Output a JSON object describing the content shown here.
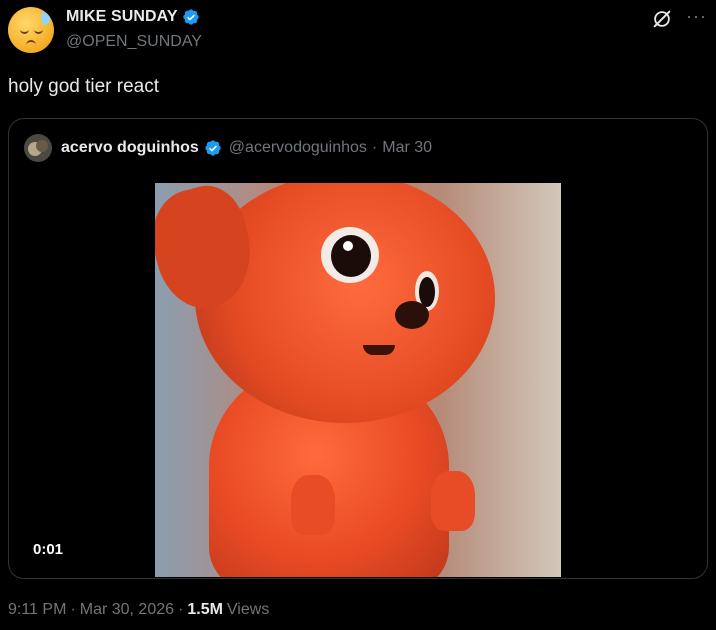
{
  "author": {
    "display_name": "MIKE SUNDAY",
    "handle": "@OPEN_SUNDAY",
    "verified": true,
    "avatar_icon": "pensive-emoji-avatar"
  },
  "header_icons": {
    "grok": "grok-icon",
    "more": "···"
  },
  "tweet": {
    "text": "holy god tier react"
  },
  "quote": {
    "display_name": "acervo doguinhos",
    "handle": "@acervodoguinhos",
    "separator": "·",
    "date": "Mar 30",
    "verified": true,
    "media": {
      "type": "video",
      "timestamp": "0:01"
    }
  },
  "footer": {
    "time": "9:11 PM",
    "sep1": "·",
    "date": "Mar 30, 2026",
    "sep2": "·",
    "views_count": "1.5M",
    "views_label": "Views"
  },
  "colors": {
    "background": "#000000",
    "text": "#e7e9ea",
    "muted": "#71767b",
    "verified": "#1d9bf0",
    "border": "#2f3336"
  }
}
